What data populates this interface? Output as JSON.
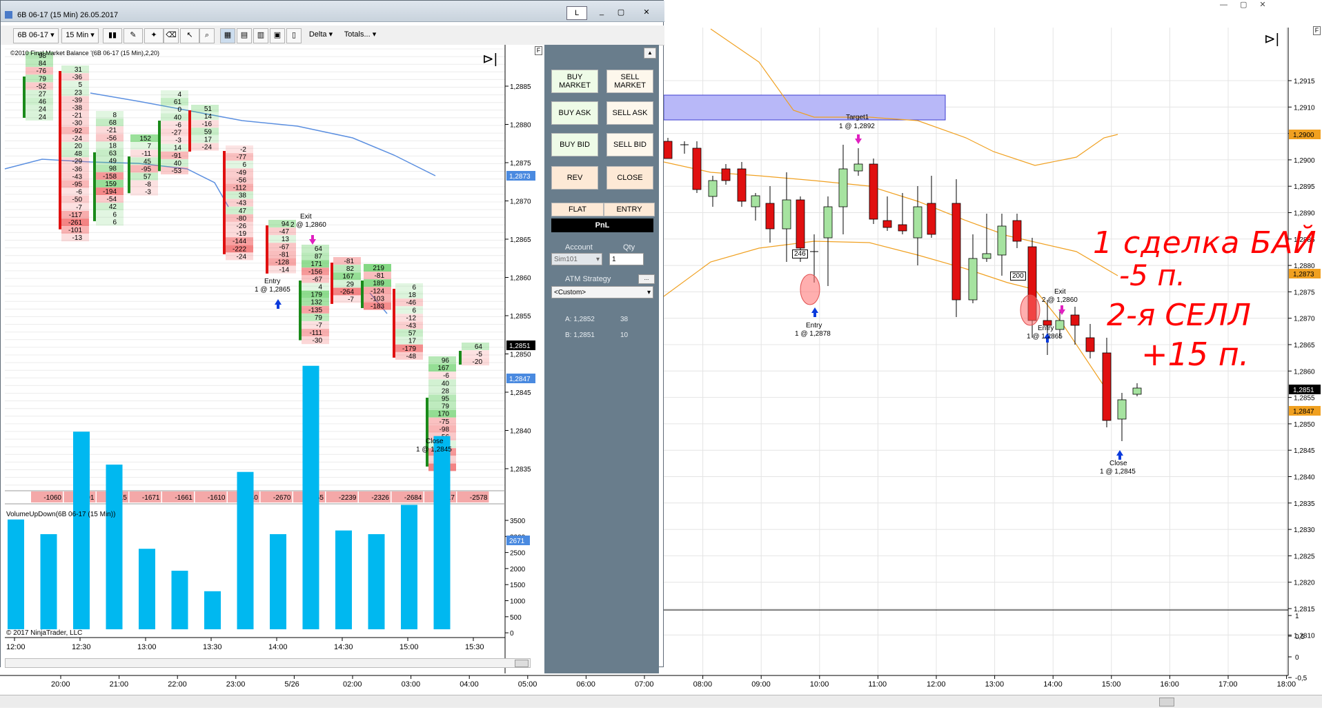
{
  "window": {
    "title": "6B 06-17 (15 Min)  26.05.2017",
    "buttons": [
      "L",
      "_",
      "▢",
      "✕"
    ]
  },
  "toolbar": {
    "instrument": "6B 06-17",
    "interval": "15 Min",
    "delta": "Delta",
    "totals": "Totals..."
  },
  "indicator_label": "©2010 Final Market Balance  '(6B 06-17 (15 Min),2,20)",
  "volume_label": "VolumeUpDown(6B 06-17 (15 Min))",
  "copyright": "© 2017 NinjaTrader, LLC",
  "price_axis_left": [
    "1,2885",
    "1,2880",
    "1,2875",
    "1,2870",
    "1,2865",
    "1,2860",
    "1,2855",
    "1,2850",
    "1,2845",
    "1,2840",
    "1,2835"
  ],
  "price_badges_left": {
    "blue1": "1,2873",
    "black": "1,2851",
    "blue2": "1,2847"
  },
  "vol_axis": [
    "3500",
    "3000",
    "2500",
    "2000",
    "1500",
    "1000",
    "500",
    "0"
  ],
  "vol_badge": "2671",
  "time_axis_left": [
    "12:00",
    "12:30",
    "13:00",
    "13:30",
    "14:00",
    "14:30",
    "15:00",
    "15:30"
  ],
  "delta_totals": [
    "-1060",
    "-1891",
    "-1815",
    "-1671",
    "-1661",
    "-1610",
    "-2440",
    "-2670",
    "-2165",
    "-2239",
    "-2326",
    "-2684",
    "-2617",
    "-2578"
  ],
  "footprint_annotations": {
    "exit": "Exit",
    "exit_price": "2 @ 1,2860",
    "entry": "Entry",
    "entry_price": "1 @ 1,2865",
    "close": "Close",
    "close_price": "1 @ 1,2845"
  },
  "footprint_cells": [
    [
      "98",
      "84",
      "-76",
      "79",
      "-52",
      "27",
      "46",
      "24",
      "24"
    ],
    [
      "31",
      "-36",
      "5",
      "23",
      "-39",
      "-38",
      "-21",
      "-30",
      "-92",
      "-24",
      "20",
      "48",
      "-29",
      "-36",
      "-43",
      "-95",
      "-6",
      "-50",
      "-7",
      "-117",
      "-261",
      "-101",
      "-13"
    ],
    [
      "8",
      "68",
      "-21",
      "-56",
      "18",
      "63",
      "49",
      "98",
      "-158",
      "159",
      "-194",
      "-54",
      "42",
      "6",
      "6"
    ],
    [
      "152",
      "7",
      "-11",
      "45",
      "-95",
      "57",
      "-8",
      "-3"
    ],
    [
      "4",
      "61",
      "0",
      "40",
      "-6",
      "-27",
      "-3",
      "14",
      "-91",
      "40",
      "-53"
    ],
    [
      "51",
      "14",
      "-16",
      "59",
      "17",
      "-24"
    ],
    [
      "-2",
      "-77",
      "6",
      "-49",
      "-56",
      "-112",
      "38",
      "-43",
      "47",
      "-80",
      "-26",
      "-19",
      "-144",
      "-222",
      "-24"
    ],
    [
      "94",
      "-47",
      "13",
      "-67",
      "-81",
      "-128",
      "-14"
    ],
    [
      "64",
      "87",
      "171",
      "-156",
      "-67",
      "4",
      "179",
      "132",
      "-135",
      "79",
      "-7",
      "-111",
      "-30"
    ],
    [
      "-81",
      "82",
      "167",
      "29",
      "-264",
      "-7"
    ],
    [
      "219",
      "-81",
      "189",
      "-124",
      "-103",
      "-183"
    ],
    [
      "6",
      "18",
      "-46",
      "6",
      "-12",
      "-43",
      "57",
      "17",
      "-179",
      "-48"
    ],
    [
      "96",
      "167",
      "-6",
      "40",
      "28",
      "95",
      "79",
      "170",
      "-75",
      "-98",
      "-56",
      "11",
      "-156",
      "-37",
      "-346"
    ],
    [
      "64",
      "-5",
      "-20"
    ]
  ],
  "panel": {
    "buy_market": "BUY MARKET",
    "sell_market": "SELL MARKET",
    "buy_ask": "BUY ASK",
    "sell_ask": "SELL ASK",
    "buy_bid": "BUY BID",
    "sell_bid": "SELL BID",
    "rev": "REV",
    "close": "CLOSE",
    "flat": "FLAT",
    "entry": "ENTRY",
    "pnl": "PnL",
    "account_label": "Account",
    "qty_label": "Qty",
    "account": "Sim101",
    "qty": "1",
    "atm_label": "ATM Strategy",
    "atm_value": "<Custom>",
    "ask_label": "A: 1,2852",
    "ask_size": "38",
    "bid_label": "B: 1,2851",
    "bid_size": "10"
  },
  "right_chart": {
    "price_axis": [
      "1,2915",
      "1,2910",
      "1,2905",
      "1,2900",
      "1,2895",
      "1,2890",
      "1,2885",
      "1,2880",
      "1,2875",
      "1,2870",
      "1,2865",
      "1,2860",
      "1,2855",
      "1,2850",
      "1,2845",
      "1,2840",
      "1,2835",
      "1,2830",
      "1,2825",
      "1,2820",
      "1,2815",
      "1,2810"
    ],
    "badges": {
      "orange1": "1,2900",
      "orange2": "1,2873",
      "black": "1,2851",
      "orange3": "1,2847"
    },
    "lower_axis": [
      "1",
      "0,5",
      "0",
      "-0,5"
    ],
    "target_label": "Target1",
    "target_price": "1 @ 1,2892",
    "entry1_label": "Entry",
    "entry1_price": "1 @ 1,2878",
    "box1": "246",
    "box2": "200",
    "exit_label": "Exit",
    "exit_price": "2 @ 1,2860",
    "entry2_label": "Entry",
    "entry2_price": "1 @ 1,2865",
    "close_label": "Close",
    "close_price": "1 @ 1,2845",
    "handwriting": [
      "1 сделка БАЙ",
      "-5 п.",
      "2-я СЕЛЛ",
      "+15 п."
    ]
  },
  "time_axis_bottom": [
    "20:00",
    "21:00",
    "22:00",
    "23:00",
    "5/26",
    "02:00",
    "03:00",
    "04:00",
    "05:00",
    "06:00",
    "07:00",
    "08:00",
    "09:00",
    "10:00",
    "11:00",
    "12:00",
    "13:00",
    "14:00",
    "15:00",
    "16:00",
    "17:00",
    "18:00"
  ],
  "colors": {
    "bull": "#a6e3a0",
    "bear": "#e01010",
    "ema": "#5b8fe0",
    "vol": "#00b8f0",
    "band": "#f0a020",
    "zone": "#b8b8f8",
    "panel": "#697d8c"
  }
}
